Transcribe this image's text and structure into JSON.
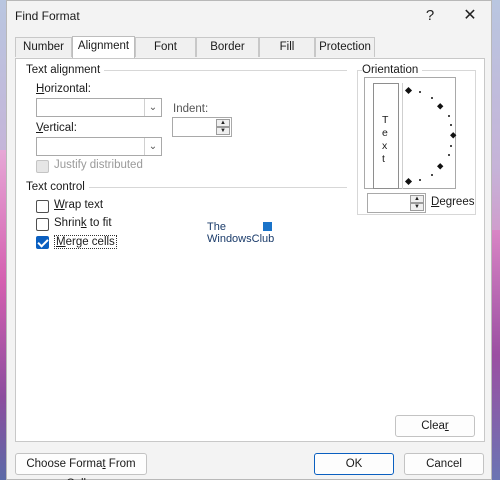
{
  "window": {
    "title": "Find Format",
    "help": "?",
    "close": "✕"
  },
  "tabs": [
    {
      "label": "Number"
    },
    {
      "label": "Alignment"
    },
    {
      "label": "Font"
    },
    {
      "label": "Border"
    },
    {
      "label": "Fill"
    },
    {
      "label": "Protection"
    }
  ],
  "text_alignment": {
    "group_label": "Text alignment",
    "horizontal_label_first": "H",
    "horizontal_label_rest": "orizontal:",
    "vertical_label_first": "V",
    "vertical_label_rest": "ertical:",
    "indent_label": "Indent:",
    "horizontal_value": "",
    "vertical_value": "",
    "indent_value": "",
    "justify_distributed": "Justify distributed"
  },
  "text_control": {
    "group_label": "Text control",
    "wrap_first": "W",
    "wrap_rest": "rap text",
    "shrink_first": "Shrin",
    "shrink_mid": "k",
    "shrink_rest": " to fit",
    "merge_first": "M",
    "merge_rest": "erge cells",
    "wrap_checked": false,
    "shrink_checked": false,
    "merge_checked": true
  },
  "orientation": {
    "group_label": "Orientation",
    "vertical_text": [
      "T",
      "e",
      "x",
      "t"
    ],
    "degrees_value": "",
    "degrees_first": "D",
    "degrees_rest": "egrees"
  },
  "watermark": {
    "line1": "The",
    "line2": "WindowsClub"
  },
  "buttons": {
    "clear_first": "Clea",
    "clear_underline": "r",
    "choose_format_first": "Choose Forma",
    "choose_format_underline": "t",
    "choose_format_rest": " From Cell...",
    "ok": "OK",
    "cancel": "Cancel"
  }
}
